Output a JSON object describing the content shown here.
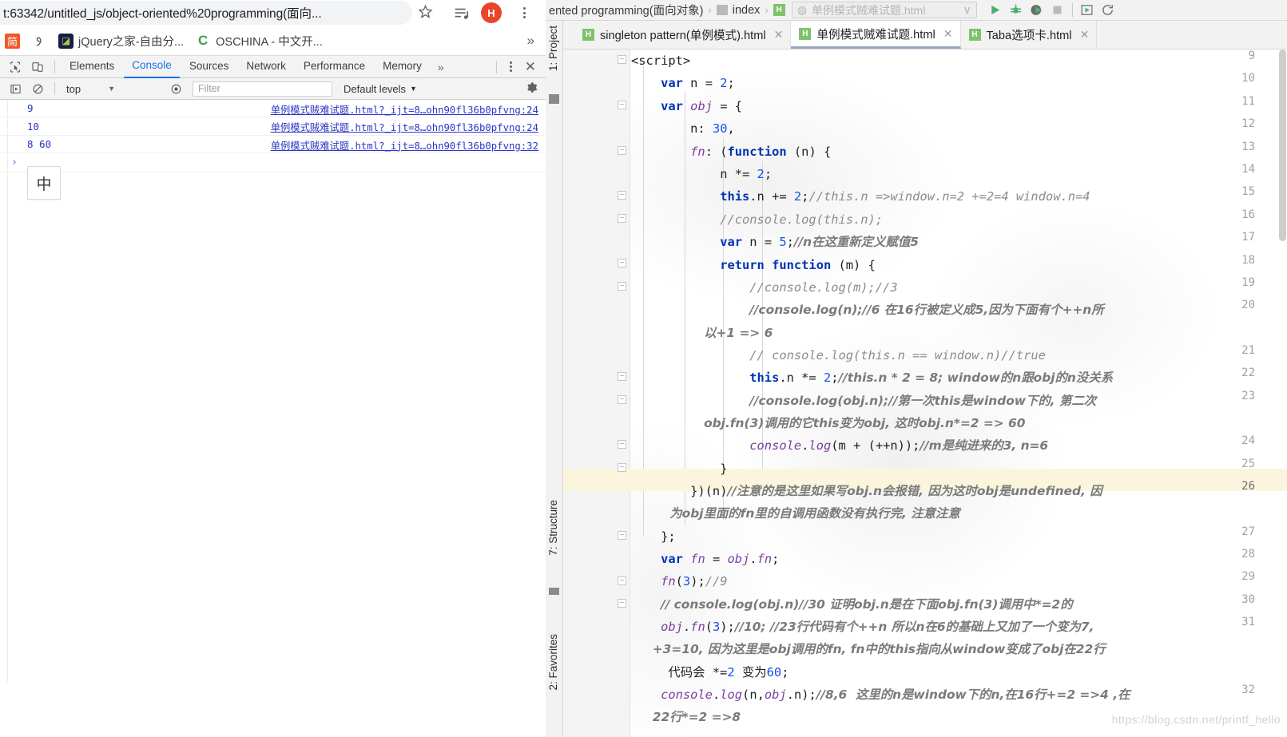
{
  "browser": {
    "omnibox": {
      "url": "t:63342/untitled_js/object-oriented%20programming(面向...",
      "star_icon": "☆",
      "media_icon": "media-control-icon",
      "avatar_letter": "H",
      "menu_icon": "kebab-menu-icon"
    },
    "bookmarks": {
      "items": [
        {
          "icon": "ime-jian-icon",
          "glyph": "简",
          "label": ""
        },
        {
          "icon": "pen-icon",
          "glyph": "ʃ",
          "label": ""
        },
        {
          "icon": "jquery-site-icon",
          "glyph": "◪",
          "label": "jQuery之家-自由分..."
        },
        {
          "icon": "oschina-icon",
          "glyph": "C",
          "label": "OSCHINA - 中文开..."
        }
      ],
      "overflow_label": "»"
    }
  },
  "devtools": {
    "toolbar": {
      "inspect_icon": "inspect-element-icon",
      "device_icon": "device-toolbar-icon",
      "tabs": [
        {
          "label": "Elements",
          "active": false
        },
        {
          "label": "Console",
          "active": true
        },
        {
          "label": "Sources",
          "active": false
        },
        {
          "label": "Network",
          "active": false
        },
        {
          "label": "Performance",
          "active": false
        },
        {
          "label": "Memory",
          "active": false
        }
      ],
      "more_tabs": "»",
      "menu_icon": "kebab-menu-icon",
      "close_icon": "✕"
    },
    "filterbar": {
      "execute_icon": "execute-icon",
      "clear_icon": "clear-console-icon",
      "context": "top",
      "caret": "▼",
      "eye_icon": "live-expression-icon",
      "filter_placeholder": "Filter",
      "levels": "Default levels",
      "levels_caret": "▼",
      "settings_icon": "gear-icon"
    },
    "console": {
      "rows": [
        {
          "value": "9",
          "source": "单例模式贼难试题.html?_ijt=8…ohn90fl36b0pfvng:24"
        },
        {
          "value": "10",
          "source": "单例模式贼难试题.html?_ijt=8…ohn90fl36b0pfvng:24"
        },
        {
          "value": "8 60",
          "source": "单例模式贼难试题.html?_ijt=8…ohn90fl36b0pfvng:32"
        }
      ],
      "prompt": "›",
      "ime_indicator": "中"
    }
  },
  "ide": {
    "breadcrumb": {
      "path_text": "ented programming(面向对象)",
      "sep": "›",
      "index_label": "index",
      "sep2": "›",
      "file_icon": "html-file-icon"
    },
    "run_config": {
      "label": "单例模式贼难试题.html",
      "caret": "∨",
      "browser_icon": "chrome-icon"
    },
    "toolbar_buttons": [
      {
        "name": "run-button",
        "glyph": "▶"
      },
      {
        "name": "debug-button",
        "glyph": "🐞"
      },
      {
        "name": "run-with-coverage-button",
        "glyph": "▶"
      },
      {
        "name": "stop-button",
        "glyph": "■"
      },
      {
        "name": "run-in-browser-button",
        "glyph": "▶"
      },
      {
        "name": "rerun-button",
        "glyph": "↻"
      }
    ],
    "tabs": [
      {
        "label": "singleton pattern(单例模式).html",
        "active": false,
        "close": "✕"
      },
      {
        "label": "单例模式贼难试题.html",
        "active": true,
        "close": "✕"
      },
      {
        "label": "Taba选项卡.html",
        "active": false,
        "close": "✕"
      }
    ],
    "side_strips": [
      {
        "label": "1: Project",
        "icon": "project-folder-icon"
      },
      {
        "label": "7: Structure",
        "icon": "structure-icon"
      },
      {
        "label": "2: Favorites",
        "icon": "favorites-icon"
      }
    ],
    "watermark": "https://blog.csdn.net/printf_hello",
    "code": {
      "lines": [
        {
          "num": "9",
          "text": "<script>"
        },
        {
          "num": "10",
          "text": "    var n = 2;"
        },
        {
          "num": "11",
          "text": "    var obj = {"
        },
        {
          "num": "12",
          "text": "        n: 30,"
        },
        {
          "num": "13",
          "text": "        fn: (function (n) {"
        },
        {
          "num": "14",
          "text": "            n *= 2;"
        },
        {
          "num": "15",
          "text": "            this.n += 2;//this.n =>window.n=2 +=2=4 window.n=4"
        },
        {
          "num": "16",
          "text": "            //console.log(this.n);"
        },
        {
          "num": "17",
          "text": "            var n = 5;//n在这重新定义赋值5"
        },
        {
          "num": "18",
          "text": "            return function (m) {"
        },
        {
          "num": "19",
          "text": "                //console.log(m);//3"
        },
        {
          "num": "20",
          "text": "                //console.log(n);//6 在16行被定义成5,因为下面有个++n所"
        },
        {
          "num": "",
          "text": "                 以+1 => 6"
        },
        {
          "num": "21",
          "text": "                // console.log(this.n == window.n)//true"
        },
        {
          "num": "22",
          "text": "                this.n *= 2;//this.n * 2 = 8; window的n跟obj的n没关系"
        },
        {
          "num": "23",
          "text": "                //console.log(obj.n);//第一次this是window下的, 第二次"
        },
        {
          "num": "",
          "text": "                 obj.fn(3)调用的它this变为obj, 这时obj.n*=2 => 60"
        },
        {
          "num": "24",
          "text": "                console.log(m + (++n));//m是纯进来的3, n=6"
        },
        {
          "num": "25",
          "text": "            }"
        },
        {
          "num": "26",
          "text": "        })(n)//注意的是这里如果写obj.n会报错, 因为这时obj是undefined, 因"
        },
        {
          "num": "",
          "text": "         为obj里面的fn里的自调用函数没有执行完, 注意注意"
        },
        {
          "num": "27",
          "text": "    };"
        },
        {
          "num": "28",
          "text": "    var fn = obj.fn;"
        },
        {
          "num": "29",
          "text": "    fn(3);//9"
        },
        {
          "num": "30",
          "text": "    // console.log(obj.n)//30 证明obj.n是在下面obj.fn(3)调用中*=2的"
        },
        {
          "num": "31",
          "text": "    obj.fn(3);//10; //23行代码有个++n 所以n在6的基础上又加了一个变为7,"
        },
        {
          "num": "",
          "text": "     +3=10, 因为这里是obj调用的fn, fn中的this指向从window变成了obj在22行"
        },
        {
          "num": "",
          "text": "     代码会 *=2 变为60;"
        },
        {
          "num": "32",
          "text": "    console.log(n,obj.n);//8,6  这里的n是window下的n,在16行+=2 =>4 ,在"
        },
        {
          "num": "",
          "text": "     22行*=2 =>8"
        }
      ]
    }
  },
  "colors": {
    "chrome_accent": "#1a73e8",
    "ide_green": "#7ec36a",
    "keyword_blue": "#0033b3",
    "number_blue": "#1750eb",
    "comment_gray": "#8c8c8c",
    "highlight_yellow": "#f6eab0",
    "highlight_blue": "#b4d7f7",
    "avatar_red": "#e8452c"
  }
}
